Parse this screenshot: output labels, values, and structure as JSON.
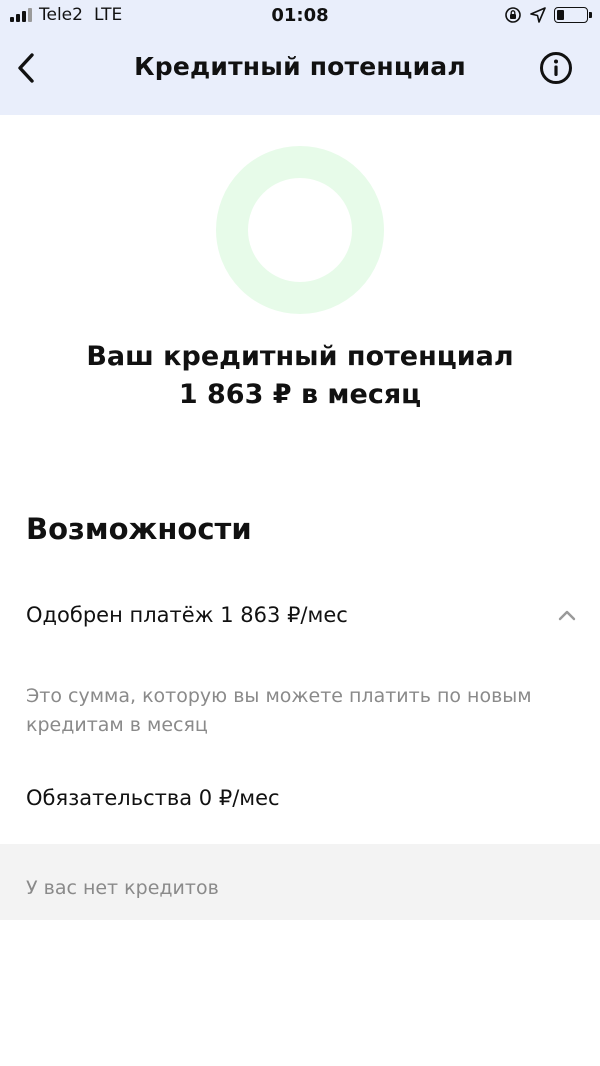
{
  "status_bar": {
    "carrier": "Tele2",
    "network": "LTE",
    "time": "01:08"
  },
  "header": {
    "title": "Кредитный потенциал"
  },
  "summary": {
    "line1": "Ваш кредитный потенциал",
    "line2": "1 863 ₽ в месяц",
    "ring_color": "#e7fbe9"
  },
  "section": {
    "title": "Возможности",
    "approved_label": "Одобрен платёж 1 863 ₽/мес",
    "approved_description": "Это сумма, которую вы можете платить по новым кредитам в месяц",
    "obligations_label": "Обязательства 0 ₽/мес",
    "no_credits_text": "У вас нет кредитов"
  },
  "colors": {
    "header_bg": "#e9eefb",
    "muted_text": "#8a8a8a",
    "no_credits_bg": "#f3f3f3"
  }
}
